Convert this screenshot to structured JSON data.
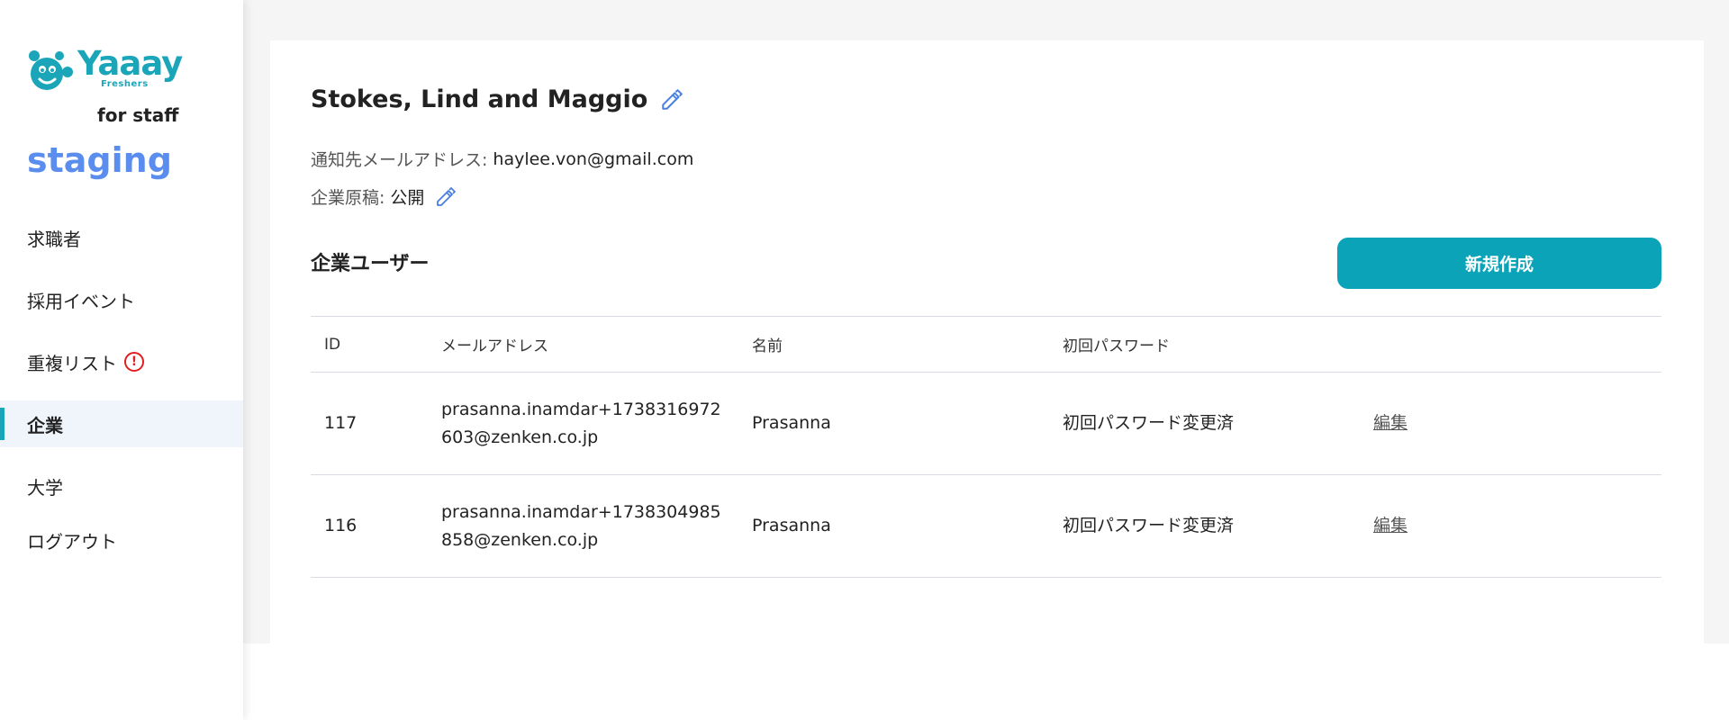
{
  "sidebar": {
    "logo_text": "Yaaay",
    "logo_subtext": "Freshers",
    "for_staff": "for staff",
    "environment": "staging",
    "items": [
      {
        "label": "求職者"
      },
      {
        "label": "採用イベント"
      },
      {
        "label": "重複リスト"
      },
      {
        "label": "企業"
      },
      {
        "label": "大学"
      },
      {
        "label": "ログアウト"
      }
    ],
    "alert_glyph": "!",
    "active_item": "企業"
  },
  "company": {
    "name": "Stokes, Lind and Maggio",
    "notify_email_label": "通知先メールアドレス:",
    "notify_email": "haylee.von@gmail.com",
    "manuscript_label": "企業原稿:",
    "manuscript_status": "公開"
  },
  "users_section": {
    "title": "企業ユーザー",
    "create_button": "新規作成",
    "columns": [
      "ID",
      "メールアドレス",
      "名前",
      "初回パスワード"
    ],
    "rows": [
      {
        "id": "117",
        "email": "prasanna.inamdar+1738316972603@zenken.co.jp",
        "name": "Prasanna",
        "password_status": "初回パスワード変更済",
        "action": "編集"
      },
      {
        "id": "116",
        "email": "prasanna.inamdar+1738304985858@zenken.co.jp",
        "name": "Prasanna",
        "password_status": "初回パスワード変更済",
        "action": "編集"
      }
    ]
  },
  "colors": {
    "brand_teal": "#1aa6b8",
    "button_teal": "#0aa3b8",
    "staging_blue": "#5b8dee",
    "alert_red": "#e02020",
    "pencil_blue": "#4a7fe0"
  }
}
